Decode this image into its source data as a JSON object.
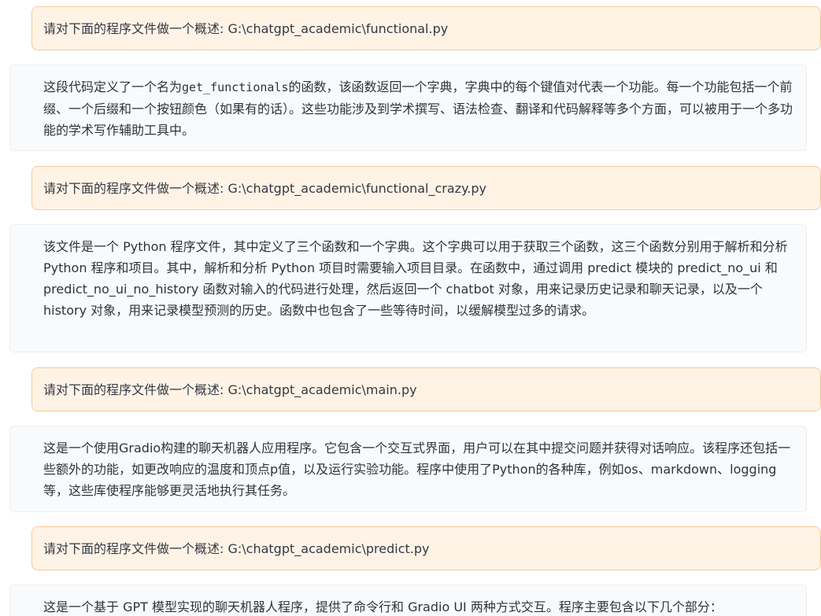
{
  "messages": [
    {
      "role": "user",
      "text": "请对下面的程序文件做一个概述: G:\\chatgpt_academic\\functional.py"
    },
    {
      "role": "bot",
      "prefix": "这段代码定义了一个名为",
      "code": "get_functionals",
      "suffix": "的函数，该函数返回一个字典，字典中的每个键值对代表一个功能。每一个功能包括一个前缀、一个后缀和一个按钮颜色（如果有的话）。这些功能涉及到学术撰写、语法检查、翻译和代码解释等多个方面，可以被用于一个多功能的学术写作辅助工具中。"
    },
    {
      "role": "user",
      "text": "请对下面的程序文件做一个概述: G:\\chatgpt_academic\\functional_crazy.py"
    },
    {
      "role": "bot",
      "text": "该文件是一个 Python 程序文件，其中定义了三个函数和一个字典。这个字典可以用于获取三个函数，这三个函数分别用于解析和分析 Python 程序和项目。其中，解析和分析 Python 项目时需要输入项目目录。在函数中，通过调用 predict 模块的 predict_no_ui 和 predict_no_ui_no_history 函数对输入的代码进行处理，然后返回一个 chatbot 对象，用来记录历史记录和聊天记录，以及一个 history 对象，用来记录模型预测的历史。函数中也包含了一些等待时间，以缓解模型过多的请求。"
    },
    {
      "role": "user",
      "text": "请对下面的程序文件做一个概述: G:\\chatgpt_academic\\main.py"
    },
    {
      "role": "bot",
      "text": "这是一个使用Gradio构建的聊天机器人应用程序。它包含一个交互式界面，用户可以在其中提交问题并获得对话响应。该程序还包括一些额外的功能，如更改响应的温度和顶点p值，以及运行实验功能。程序中使用了Python的各种库，例如os、markdown、logging等，这些库使程序能够更灵活地执行其任务。"
    },
    {
      "role": "user",
      "text": "请对下面的程序文件做一个概述: G:\\chatgpt_academic\\predict.py"
    },
    {
      "role": "bot",
      "text": "这是一个基于 GPT 模型实现的聊天机器人程序，提供了命令行和 Gradio UI 两种方式交互。程序主要包含以下几个部分："
    }
  ],
  "colors": {
    "user_bubble_bg": "#fff3e6",
    "user_bubble_border": "#f7c896",
    "bot_bubble_bg": "#f9fafb",
    "bot_bubble_border": "#eceef1"
  }
}
